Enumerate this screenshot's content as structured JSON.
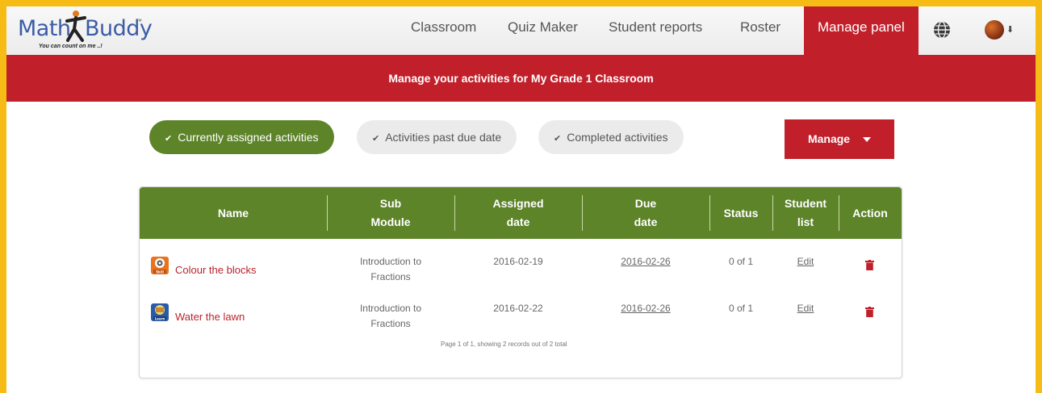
{
  "brand": {
    "logo_left": "Math",
    "logo_right": "Buddy",
    "logo_tm": "™",
    "tagline": "You can count on me ..!"
  },
  "nav": {
    "items": [
      {
        "label": "Classroom"
      },
      {
        "label": "Quiz Maker"
      },
      {
        "label": "Student reports"
      },
      {
        "label": "Roster"
      },
      {
        "label": "Manage panel"
      }
    ],
    "globe_icon": "globe-icon",
    "avatar_icon": "user-avatar"
  },
  "banner": {
    "text": "Manage your activities for My Grade 1 Classroom"
  },
  "filters": [
    {
      "label": "Currently assigned activities",
      "active": true
    },
    {
      "label": "Activities past due date",
      "active": false
    },
    {
      "label": "Completed activities",
      "active": false
    }
  ],
  "manage_button": {
    "label": "Manage"
  },
  "table": {
    "headers": {
      "name": "Name",
      "sub_module_1": "Sub",
      "sub_module_2": "Module",
      "assigned_1": "Assigned",
      "assigned_2": "date",
      "due_1": "Due",
      "due_2": "date",
      "status": "Status",
      "student_1": "Student",
      "student_2": "list",
      "action": "Action"
    },
    "rows": [
      {
        "name": "Colour the blocks",
        "icon_label": "Skill",
        "sub_module_1": "Introduction to",
        "sub_module_2": "Fractions",
        "assigned_date": "2016-02-19",
        "due_date": "2016-02-26",
        "status": "0 of 1",
        "student_list": "Edit"
      },
      {
        "name": "Water the lawn",
        "icon_label": "Learn",
        "sub_module_1": "Introduction to",
        "sub_module_2": "Fractions",
        "assigned_date": "2016-02-22",
        "due_date": "2016-02-26",
        "status": "0 of 1",
        "student_list": "Edit"
      }
    ],
    "pagination": "Page 1 of 1, showing 2 records out of 2 total"
  },
  "colors": {
    "frame": "#f7bb16",
    "accent_red": "#c1202b",
    "accent_green": "#5d8429"
  }
}
